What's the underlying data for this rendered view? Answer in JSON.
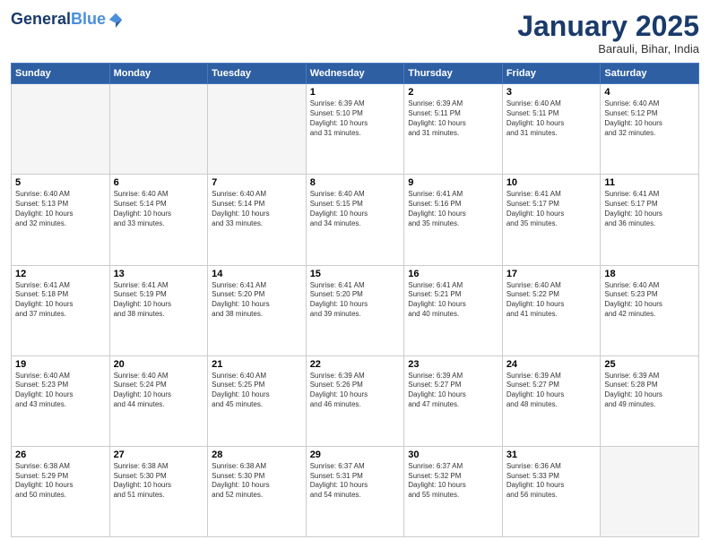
{
  "header": {
    "logo_line1": "General",
    "logo_line2": "Blue",
    "title": "January 2025",
    "subtitle": "Barauli, Bihar, India"
  },
  "weekdays": [
    "Sunday",
    "Monday",
    "Tuesday",
    "Wednesday",
    "Thursday",
    "Friday",
    "Saturday"
  ],
  "weeks": [
    [
      {
        "day": "",
        "info": ""
      },
      {
        "day": "",
        "info": ""
      },
      {
        "day": "",
        "info": ""
      },
      {
        "day": "1",
        "info": "Sunrise: 6:39 AM\nSunset: 5:10 PM\nDaylight: 10 hours\nand 31 minutes."
      },
      {
        "day": "2",
        "info": "Sunrise: 6:39 AM\nSunset: 5:11 PM\nDaylight: 10 hours\nand 31 minutes."
      },
      {
        "day": "3",
        "info": "Sunrise: 6:40 AM\nSunset: 5:11 PM\nDaylight: 10 hours\nand 31 minutes."
      },
      {
        "day": "4",
        "info": "Sunrise: 6:40 AM\nSunset: 5:12 PM\nDaylight: 10 hours\nand 32 minutes."
      }
    ],
    [
      {
        "day": "5",
        "info": "Sunrise: 6:40 AM\nSunset: 5:13 PM\nDaylight: 10 hours\nand 32 minutes."
      },
      {
        "day": "6",
        "info": "Sunrise: 6:40 AM\nSunset: 5:14 PM\nDaylight: 10 hours\nand 33 minutes."
      },
      {
        "day": "7",
        "info": "Sunrise: 6:40 AM\nSunset: 5:14 PM\nDaylight: 10 hours\nand 33 minutes."
      },
      {
        "day": "8",
        "info": "Sunrise: 6:40 AM\nSunset: 5:15 PM\nDaylight: 10 hours\nand 34 minutes."
      },
      {
        "day": "9",
        "info": "Sunrise: 6:41 AM\nSunset: 5:16 PM\nDaylight: 10 hours\nand 35 minutes."
      },
      {
        "day": "10",
        "info": "Sunrise: 6:41 AM\nSunset: 5:17 PM\nDaylight: 10 hours\nand 35 minutes."
      },
      {
        "day": "11",
        "info": "Sunrise: 6:41 AM\nSunset: 5:17 PM\nDaylight: 10 hours\nand 36 minutes."
      }
    ],
    [
      {
        "day": "12",
        "info": "Sunrise: 6:41 AM\nSunset: 5:18 PM\nDaylight: 10 hours\nand 37 minutes."
      },
      {
        "day": "13",
        "info": "Sunrise: 6:41 AM\nSunset: 5:19 PM\nDaylight: 10 hours\nand 38 minutes."
      },
      {
        "day": "14",
        "info": "Sunrise: 6:41 AM\nSunset: 5:20 PM\nDaylight: 10 hours\nand 38 minutes."
      },
      {
        "day": "15",
        "info": "Sunrise: 6:41 AM\nSunset: 5:20 PM\nDaylight: 10 hours\nand 39 minutes."
      },
      {
        "day": "16",
        "info": "Sunrise: 6:41 AM\nSunset: 5:21 PM\nDaylight: 10 hours\nand 40 minutes."
      },
      {
        "day": "17",
        "info": "Sunrise: 6:40 AM\nSunset: 5:22 PM\nDaylight: 10 hours\nand 41 minutes."
      },
      {
        "day": "18",
        "info": "Sunrise: 6:40 AM\nSunset: 5:23 PM\nDaylight: 10 hours\nand 42 minutes."
      }
    ],
    [
      {
        "day": "19",
        "info": "Sunrise: 6:40 AM\nSunset: 5:23 PM\nDaylight: 10 hours\nand 43 minutes."
      },
      {
        "day": "20",
        "info": "Sunrise: 6:40 AM\nSunset: 5:24 PM\nDaylight: 10 hours\nand 44 minutes."
      },
      {
        "day": "21",
        "info": "Sunrise: 6:40 AM\nSunset: 5:25 PM\nDaylight: 10 hours\nand 45 minutes."
      },
      {
        "day": "22",
        "info": "Sunrise: 6:39 AM\nSunset: 5:26 PM\nDaylight: 10 hours\nand 46 minutes."
      },
      {
        "day": "23",
        "info": "Sunrise: 6:39 AM\nSunset: 5:27 PM\nDaylight: 10 hours\nand 47 minutes."
      },
      {
        "day": "24",
        "info": "Sunrise: 6:39 AM\nSunset: 5:27 PM\nDaylight: 10 hours\nand 48 minutes."
      },
      {
        "day": "25",
        "info": "Sunrise: 6:39 AM\nSunset: 5:28 PM\nDaylight: 10 hours\nand 49 minutes."
      }
    ],
    [
      {
        "day": "26",
        "info": "Sunrise: 6:38 AM\nSunset: 5:29 PM\nDaylight: 10 hours\nand 50 minutes."
      },
      {
        "day": "27",
        "info": "Sunrise: 6:38 AM\nSunset: 5:30 PM\nDaylight: 10 hours\nand 51 minutes."
      },
      {
        "day": "28",
        "info": "Sunrise: 6:38 AM\nSunset: 5:30 PM\nDaylight: 10 hours\nand 52 minutes."
      },
      {
        "day": "29",
        "info": "Sunrise: 6:37 AM\nSunset: 5:31 PM\nDaylight: 10 hours\nand 54 minutes."
      },
      {
        "day": "30",
        "info": "Sunrise: 6:37 AM\nSunset: 5:32 PM\nDaylight: 10 hours\nand 55 minutes."
      },
      {
        "day": "31",
        "info": "Sunrise: 6:36 AM\nSunset: 5:33 PM\nDaylight: 10 hours\nand 56 minutes."
      },
      {
        "day": "",
        "info": ""
      }
    ]
  ]
}
